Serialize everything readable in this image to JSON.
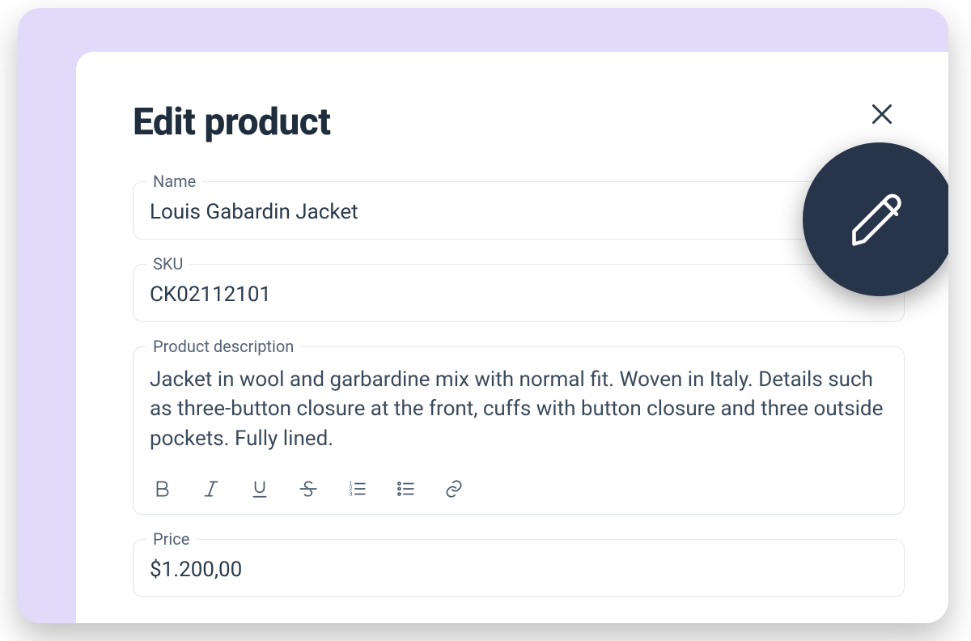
{
  "page": {
    "title": "Edit product"
  },
  "fields": {
    "name": {
      "label": "Name",
      "value": "Louis Gabardin Jacket"
    },
    "sku": {
      "label": "SKU",
      "value": "CK02112101"
    },
    "description": {
      "label": "Product description",
      "value": "Jacket in wool and garbardine mix with normal fit. Woven in Italy. Details such as three-button closure at the front, cuffs with button closure and three outside pockets. Fully lined."
    },
    "price": {
      "label": "Price",
      "value": "$1.200,00"
    }
  },
  "toolbar": {
    "bold": "Bold",
    "italic": "Italic",
    "underline": "Underline",
    "strike": "Strikethrough",
    "ol": "Ordered list",
    "ul": "Unordered list",
    "link": "Link"
  },
  "colors": {
    "accent_bg": "#e1daf9",
    "fab_bg": "#27344a",
    "text_primary": "#1f2d3d",
    "border": "#e2e6ea"
  }
}
